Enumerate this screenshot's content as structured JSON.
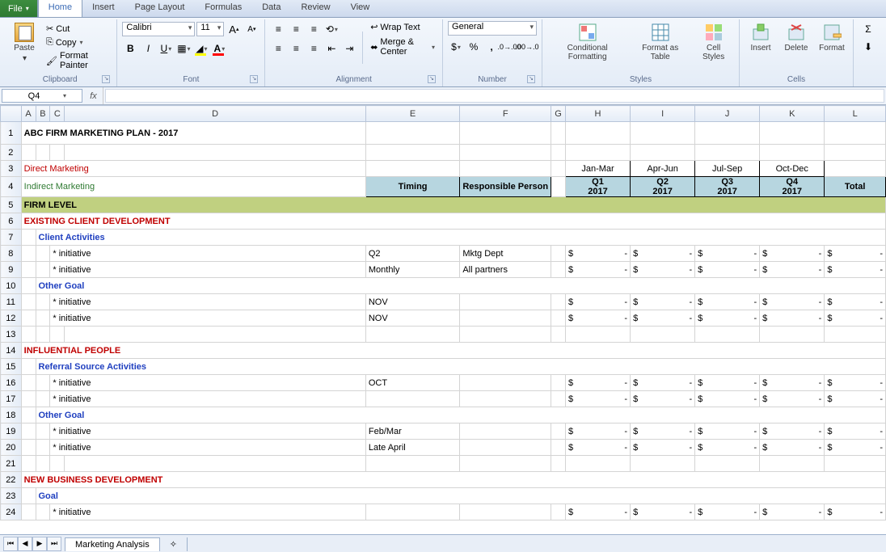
{
  "tabs": {
    "file": "File",
    "list": [
      "Home",
      "Insert",
      "Page Layout",
      "Formulas",
      "Data",
      "Review",
      "View"
    ],
    "active": 0
  },
  "clipboard": {
    "paste": "Paste",
    "cut": "Cut",
    "copy": "Copy",
    "fmt": "Format Painter",
    "label": "Clipboard"
  },
  "font": {
    "name": "Calibri",
    "size": "11",
    "label": "Font"
  },
  "alignment": {
    "wrap": "Wrap Text",
    "merge": "Merge & Center",
    "label": "Alignment"
  },
  "number": {
    "format": "General",
    "label": "Number"
  },
  "styles": {
    "cond": "Conditional Formatting",
    "table": "Format as Table",
    "cell": "Cell Styles",
    "label": "Styles"
  },
  "cells": {
    "insert": "Insert",
    "delete": "Delete",
    "format": "Format",
    "label": "Cells"
  },
  "namebox": "Q4",
  "columns": [
    "A",
    "B",
    "C",
    "D",
    "E",
    "F",
    "G",
    "H",
    "I",
    "J",
    "K",
    "L"
  ],
  "periods": [
    "Jan-Mar",
    "Apr-Jun",
    "Jul-Sep",
    "Oct-Dec"
  ],
  "qheaders": [
    "Q1",
    "Q2",
    "Q3",
    "Q4"
  ],
  "qyear": "2017",
  "headers": {
    "timing": "Timing",
    "resp": "Responsible Person",
    "total": "Total"
  },
  "rows": [
    {
      "n": 1,
      "type": "title",
      "text": "ABC FIRM MARKETING PLAN - 2017"
    },
    {
      "n": 2,
      "type": "blank"
    },
    {
      "n": 3,
      "type": "periods"
    },
    {
      "n": 4,
      "type": "header2",
      "a": "Direct Marketing",
      "b": "Indirect Marketing"
    },
    {
      "n": 5,
      "type": "firm",
      "text": "FIRM LEVEL"
    },
    {
      "n": 6,
      "type": "red",
      "text": "EXISTING CLIENT DEVELOPMENT"
    },
    {
      "n": 7,
      "type": "blue",
      "text": "Client Activities"
    },
    {
      "n": 8,
      "type": "item",
      "text": "* initiative",
      "timing": "Q2",
      "resp": "Mktg Dept",
      "money": true
    },
    {
      "n": 9,
      "type": "item",
      "text": "* initiative",
      "timing": "Monthly",
      "resp": "All partners",
      "money": true
    },
    {
      "n": 10,
      "type": "blue",
      "text": "Other Goal"
    },
    {
      "n": 11,
      "type": "item",
      "text": "* initiative",
      "timing": "NOV",
      "resp": "",
      "money": true
    },
    {
      "n": 12,
      "type": "item",
      "text": "* initiative",
      "timing": "NOV",
      "resp": "",
      "money": true
    },
    {
      "n": 13,
      "type": "blank"
    },
    {
      "n": 14,
      "type": "red",
      "text": "INFLUENTIAL PEOPLE"
    },
    {
      "n": 15,
      "type": "blue",
      "text": "Referral Source Activities"
    },
    {
      "n": 16,
      "type": "item",
      "text": "* initiative",
      "timing": "OCT",
      "resp": "",
      "money": true
    },
    {
      "n": 17,
      "type": "item",
      "text": "* initiative",
      "timing": "",
      "resp": "",
      "money": true
    },
    {
      "n": 18,
      "type": "blue",
      "text": "Other Goal"
    },
    {
      "n": 19,
      "type": "item",
      "text": "* initiative",
      "timing": "Feb/Mar",
      "resp": "",
      "money": true
    },
    {
      "n": 20,
      "type": "item",
      "text": "* initiative",
      "timing": "Late April",
      "resp": "",
      "money": true
    },
    {
      "n": 21,
      "type": "blank"
    },
    {
      "n": 22,
      "type": "red",
      "text": "NEW BUSINESS DEVELOPMENT"
    },
    {
      "n": 23,
      "type": "blue",
      "text": "Goal"
    },
    {
      "n": 24,
      "type": "item",
      "text": "* initiative",
      "timing": "",
      "resp": "",
      "money": true
    }
  ],
  "sheetname": "Marketing Analysis"
}
